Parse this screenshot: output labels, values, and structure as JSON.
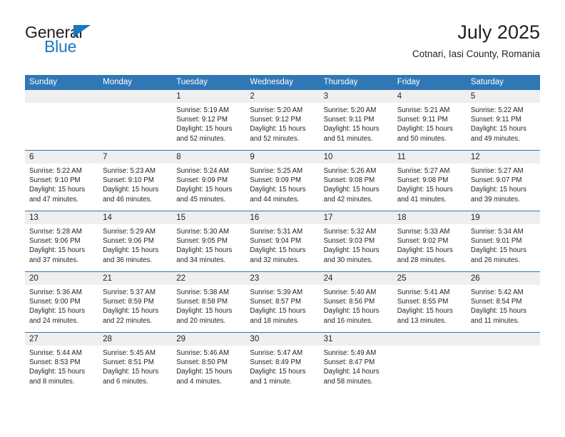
{
  "brand": {
    "name_top": "General",
    "name_bottom": "Blue",
    "accent_color": "#1b76bc"
  },
  "header": {
    "title": "July 2025",
    "subtitle": "Cotnari, Iasi County, Romania"
  },
  "theme": {
    "header_bg": "#3077b5",
    "daynum_bg": "#efefef",
    "text_color": "#231f20"
  },
  "weekday_headers": [
    "Sunday",
    "Monday",
    "Tuesday",
    "Wednesday",
    "Thursday",
    "Friday",
    "Saturday"
  ],
  "weeks": [
    [
      {
        "day": "",
        "lines": [
          "",
          "",
          "",
          ""
        ]
      },
      {
        "day": "",
        "lines": [
          "",
          "",
          "",
          ""
        ]
      },
      {
        "day": "1",
        "lines": [
          "Sunrise: 5:19 AM",
          "Sunset: 9:12 PM",
          "Daylight: 15 hours",
          "and 52 minutes."
        ]
      },
      {
        "day": "2",
        "lines": [
          "Sunrise: 5:20 AM",
          "Sunset: 9:12 PM",
          "Daylight: 15 hours",
          "and 52 minutes."
        ]
      },
      {
        "day": "3",
        "lines": [
          "Sunrise: 5:20 AM",
          "Sunset: 9:11 PM",
          "Daylight: 15 hours",
          "and 51 minutes."
        ]
      },
      {
        "day": "4",
        "lines": [
          "Sunrise: 5:21 AM",
          "Sunset: 9:11 PM",
          "Daylight: 15 hours",
          "and 50 minutes."
        ]
      },
      {
        "day": "5",
        "lines": [
          "Sunrise: 5:22 AM",
          "Sunset: 9:11 PM",
          "Daylight: 15 hours",
          "and 49 minutes."
        ]
      }
    ],
    [
      {
        "day": "6",
        "lines": [
          "Sunrise: 5:22 AM",
          "Sunset: 9:10 PM",
          "Daylight: 15 hours",
          "and 47 minutes."
        ]
      },
      {
        "day": "7",
        "lines": [
          "Sunrise: 5:23 AM",
          "Sunset: 9:10 PM",
          "Daylight: 15 hours",
          "and 46 minutes."
        ]
      },
      {
        "day": "8",
        "lines": [
          "Sunrise: 5:24 AM",
          "Sunset: 9:09 PM",
          "Daylight: 15 hours",
          "and 45 minutes."
        ]
      },
      {
        "day": "9",
        "lines": [
          "Sunrise: 5:25 AM",
          "Sunset: 9:09 PM",
          "Daylight: 15 hours",
          "and 44 minutes."
        ]
      },
      {
        "day": "10",
        "lines": [
          "Sunrise: 5:26 AM",
          "Sunset: 9:08 PM",
          "Daylight: 15 hours",
          "and 42 minutes."
        ]
      },
      {
        "day": "11",
        "lines": [
          "Sunrise: 5:27 AM",
          "Sunset: 9:08 PM",
          "Daylight: 15 hours",
          "and 41 minutes."
        ]
      },
      {
        "day": "12",
        "lines": [
          "Sunrise: 5:27 AM",
          "Sunset: 9:07 PM",
          "Daylight: 15 hours",
          "and 39 minutes."
        ]
      }
    ],
    [
      {
        "day": "13",
        "lines": [
          "Sunrise: 5:28 AM",
          "Sunset: 9:06 PM",
          "Daylight: 15 hours",
          "and 37 minutes."
        ]
      },
      {
        "day": "14",
        "lines": [
          "Sunrise: 5:29 AM",
          "Sunset: 9:06 PM",
          "Daylight: 15 hours",
          "and 36 minutes."
        ]
      },
      {
        "day": "15",
        "lines": [
          "Sunrise: 5:30 AM",
          "Sunset: 9:05 PM",
          "Daylight: 15 hours",
          "and 34 minutes."
        ]
      },
      {
        "day": "16",
        "lines": [
          "Sunrise: 5:31 AM",
          "Sunset: 9:04 PM",
          "Daylight: 15 hours",
          "and 32 minutes."
        ]
      },
      {
        "day": "17",
        "lines": [
          "Sunrise: 5:32 AM",
          "Sunset: 9:03 PM",
          "Daylight: 15 hours",
          "and 30 minutes."
        ]
      },
      {
        "day": "18",
        "lines": [
          "Sunrise: 5:33 AM",
          "Sunset: 9:02 PM",
          "Daylight: 15 hours",
          "and 28 minutes."
        ]
      },
      {
        "day": "19",
        "lines": [
          "Sunrise: 5:34 AM",
          "Sunset: 9:01 PM",
          "Daylight: 15 hours",
          "and 26 minutes."
        ]
      }
    ],
    [
      {
        "day": "20",
        "lines": [
          "Sunrise: 5:36 AM",
          "Sunset: 9:00 PM",
          "Daylight: 15 hours",
          "and 24 minutes."
        ]
      },
      {
        "day": "21",
        "lines": [
          "Sunrise: 5:37 AM",
          "Sunset: 8:59 PM",
          "Daylight: 15 hours",
          "and 22 minutes."
        ]
      },
      {
        "day": "22",
        "lines": [
          "Sunrise: 5:38 AM",
          "Sunset: 8:58 PM",
          "Daylight: 15 hours",
          "and 20 minutes."
        ]
      },
      {
        "day": "23",
        "lines": [
          "Sunrise: 5:39 AM",
          "Sunset: 8:57 PM",
          "Daylight: 15 hours",
          "and 18 minutes."
        ]
      },
      {
        "day": "24",
        "lines": [
          "Sunrise: 5:40 AM",
          "Sunset: 8:56 PM",
          "Daylight: 15 hours",
          "and 16 minutes."
        ]
      },
      {
        "day": "25",
        "lines": [
          "Sunrise: 5:41 AM",
          "Sunset: 8:55 PM",
          "Daylight: 15 hours",
          "and 13 minutes."
        ]
      },
      {
        "day": "26",
        "lines": [
          "Sunrise: 5:42 AM",
          "Sunset: 8:54 PM",
          "Daylight: 15 hours",
          "and 11 minutes."
        ]
      }
    ],
    [
      {
        "day": "27",
        "lines": [
          "Sunrise: 5:44 AM",
          "Sunset: 8:53 PM",
          "Daylight: 15 hours",
          "and 8 minutes."
        ]
      },
      {
        "day": "28",
        "lines": [
          "Sunrise: 5:45 AM",
          "Sunset: 8:51 PM",
          "Daylight: 15 hours",
          "and 6 minutes."
        ]
      },
      {
        "day": "29",
        "lines": [
          "Sunrise: 5:46 AM",
          "Sunset: 8:50 PM",
          "Daylight: 15 hours",
          "and 4 minutes."
        ]
      },
      {
        "day": "30",
        "lines": [
          "Sunrise: 5:47 AM",
          "Sunset: 8:49 PM",
          "Daylight: 15 hours",
          "and 1 minute."
        ]
      },
      {
        "day": "31",
        "lines": [
          "Sunrise: 5:49 AM",
          "Sunset: 8:47 PM",
          "Daylight: 14 hours",
          "and 58 minutes."
        ]
      },
      {
        "day": "",
        "lines": [
          "",
          "",
          "",
          ""
        ]
      },
      {
        "day": "",
        "lines": [
          "",
          "",
          "",
          ""
        ]
      }
    ]
  ]
}
